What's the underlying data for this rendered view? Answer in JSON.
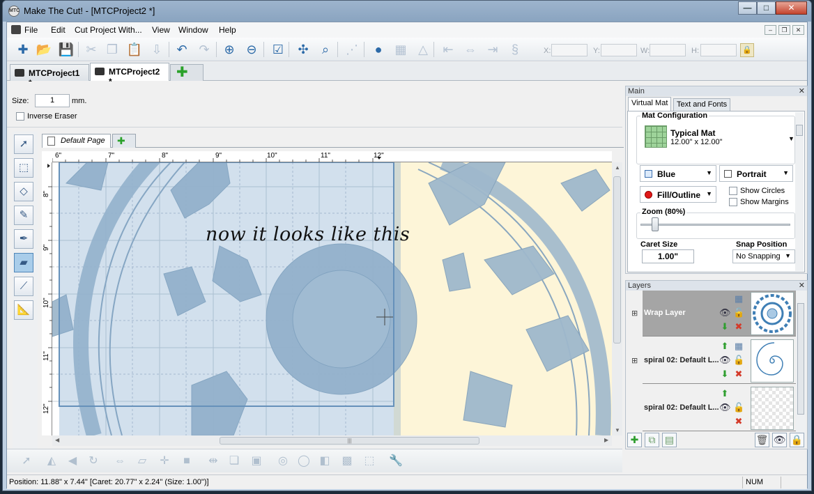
{
  "window": {
    "title": "Make The Cut! - [MTCProject2 *]",
    "app_icon": "MTC",
    "controls": [
      "minimize",
      "maximize",
      "close"
    ]
  },
  "menu": {
    "items": [
      "File",
      "Edit",
      "Cut Project With...",
      "View",
      "Window",
      "Help"
    ]
  },
  "toolbar": {
    "icons": [
      "new-icon",
      "open-icon",
      "save-icon",
      "cut-icon",
      "copy-icon",
      "paste-icon",
      "import-icon",
      "undo-icon",
      "redo-icon",
      "zoom-in-icon",
      "zoom-out-icon",
      "check-icon",
      "select-all-icon",
      "zoom-fit-icon",
      "snap-icon",
      "art-icon",
      "grid-icon",
      "shape-icon",
      "align-left-icon",
      "align-center-icon",
      "align-right-icon",
      "svg-icon"
    ],
    "coords": {
      "x_label": "X:",
      "y_label": "Y:",
      "w_label": "W:",
      "h_label": "H:",
      "x": "",
      "y": "",
      "w": "",
      "h": ""
    }
  },
  "doc_tabs": [
    {
      "label": "MTCProject1 *",
      "active": false
    },
    {
      "label": "MTCProject2 *",
      "active": true
    }
  ],
  "properties": {
    "size_label": "Size:",
    "size_value": "1",
    "size_unit": "mm.",
    "inverse_eraser_label": "Inverse Eraser",
    "inverse_eraser_checked": false
  },
  "page_tabs": {
    "current": "Default Page"
  },
  "ruler": {
    "x_ticks": [
      "6\"",
      "7\"",
      "8\"",
      "9\"",
      "10\"",
      "11\"",
      "12\""
    ],
    "y_ticks": [
      "8\"",
      "9\"",
      "10\"",
      "11\"",
      "12\""
    ]
  },
  "canvas": {
    "annotation": "now it looks like this",
    "colors": {
      "mat": "#ffffff",
      "outside": "#fdf5d8",
      "shape": "#9fb8cc",
      "selection": "#7ea7cc"
    }
  },
  "main_panel": {
    "title": "Main",
    "tabs": [
      {
        "label": "Virtual Mat",
        "active": true
      },
      {
        "label": "Text and Fonts",
        "active": false
      }
    ],
    "mat_config_title": "Mat Configuration",
    "mat_name": "Typical Mat",
    "mat_dims": "12.00\" x 12.00\"",
    "color_select": "Blue",
    "orientation_select": "Portrait",
    "fill_select": "Fill/Outline",
    "show_circles": "Show Circles",
    "show_margins": "Show Margins",
    "zoom_title": "Zoom (80%)",
    "zoom_level": 0.08,
    "caret_size_title": "Caret Size",
    "caret_size_value": "1.00\"",
    "snap_position_title": "Snap Position",
    "snap_position_value": "No Snapping"
  },
  "layers_panel": {
    "title": "Layers",
    "layers": [
      {
        "name": "Wrap Layer",
        "selected": true
      },
      {
        "name": "spiral 02: Default L...",
        "selected": false
      },
      {
        "name": "spiral 02: Default L...",
        "selected": false
      }
    ]
  },
  "status": {
    "text": "Position: 11.88\" x 7.44\" [Caret: 20.77\" x 2.24\" (Size: 1.00\")]",
    "num": "NUM"
  }
}
